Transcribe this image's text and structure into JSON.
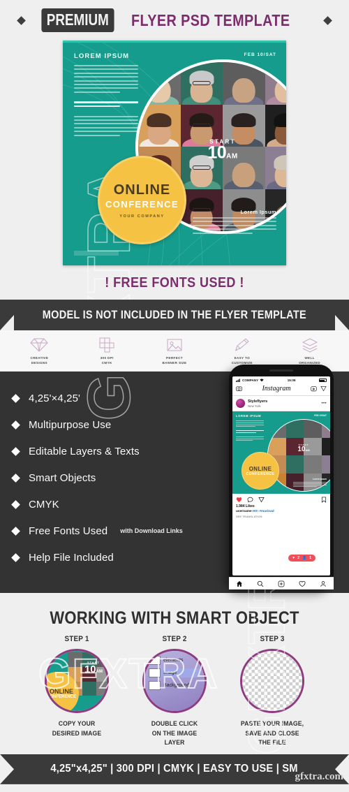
{
  "header": {
    "badge": "PREMIUM",
    "title": "FLYER PSD TEMPLATE",
    "diamond_icon": "diamond-icon"
  },
  "flyer": {
    "lorem_title": "LOREM IPSUM",
    "date": "FEB 10/SAT",
    "start_label": "START",
    "start_time": "10",
    "start_period": "AM",
    "badge_line1": "ONLINE",
    "badge_line2": "CONFERENCE",
    "badge_line3": "YOUR COMPANY",
    "footer_title": "Lorem Ipsum",
    "bg_color": "#169c8c",
    "badge_color": "#f5c243"
  },
  "free_fonts": "! FREE FONTS USED !",
  "ribbon": "MODEL IS NOT INCLUDED  IN THE FLYER TEMPLATE",
  "icon_strip": [
    {
      "icon": "diamond-icon",
      "label": "CREATIVE\nDESIGNS"
    },
    {
      "icon": "grid-icon",
      "label": "300 DPI\nCMYK"
    },
    {
      "icon": "image-icon",
      "label": "PERFECT\nBANNER SIZE"
    },
    {
      "icon": "pencil-icon",
      "label": "EASY TO\nCUSTOMIZE"
    },
    {
      "icon": "layers-icon",
      "label": "WELL\nORGANIZED"
    }
  ],
  "features": [
    {
      "text": "4,25'×4,25'",
      "sub": ""
    },
    {
      "text": "Multipurpose Use",
      "sub": ""
    },
    {
      "text": "Editable  Layers & Texts",
      "sub": ""
    },
    {
      "text": "Smart Objects",
      "sub": ""
    },
    {
      "text": "CMYK",
      "sub": ""
    },
    {
      "text": "Free Fonts Used",
      "sub": "with Download Links"
    },
    {
      "text": "Help File Included",
      "sub": ""
    }
  ],
  "phone": {
    "carrier": "COMPANY",
    "time": "15:09",
    "app_name": "Instagram",
    "user_name": "Styleflyers",
    "user_location": "New York",
    "post_title": "LOREM IPSUM",
    "post_date": "FEB 10/SAT",
    "likes": "1.984 Likes",
    "caption_user": "username",
    "caption_tag": "HI!! #marinad",
    "see_translation": "SEE TRANSLATION",
    "pill_likes": "2",
    "pill_users": "1",
    "camera_icon": "camera-icon",
    "tv_icon": "igtv-icon",
    "send_icon": "send-icon",
    "heart_icon": "heart-icon",
    "comment_icon": "comment-icon",
    "share_icon": "share-icon",
    "bookmark_icon": "bookmark-icon",
    "home_icon": "home-icon",
    "search_icon": "search-icon",
    "add_icon": "add-icon",
    "activity_icon": "activity-icon",
    "profile_icon": "profile-icon"
  },
  "smart_object": {
    "title": "WORKING WITH SMART OBJECT",
    "steps": [
      {
        "label": "STEP 1",
        "caption": "COPY YOUR\nDESIRED IMAGE"
      },
      {
        "label": "STEP 2",
        "caption": "DOUBLE CLICK\nON THE IMAGE\nLAYER"
      },
      {
        "label": "STEP 3",
        "caption": "PASTE YOUR IMAGE,\nSAVE AND CLOSE\nTHE FILE"
      }
    ],
    "layer_rows": [
      "elements",
      "Image",
      "Background"
    ]
  },
  "bottom_ribbon": "4,25\"x4,25\"  |  300 DPI  |  CMYK  |  EASY TO USE  |  SM",
  "watermarks": {
    "left": "GFXTRA",
    "mid": "GFXTRA",
    "right": "GFXTRA",
    "corner": "gfxtra.com"
  }
}
